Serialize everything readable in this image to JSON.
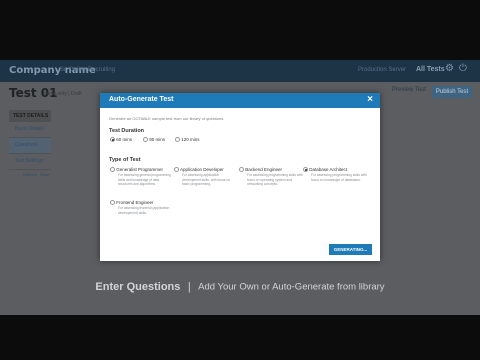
{
  "app": {
    "brand": "Company name",
    "brand_sub": "Sr. Online Recruiting",
    "project": "Production Server",
    "all_tests": "All Tests"
  },
  "test": {
    "title": "Test 01",
    "subtitle": "Invite-only | Draft",
    "preview_label": "Preview Test",
    "publish_label": "Publish Test"
  },
  "sidebar": {
    "header": "TEST DETAILS",
    "items": [
      {
        "label": "Basic Details"
      },
      {
        "label": "Questions"
      },
      {
        "label": "Test Settings"
      }
    ],
    "subitems": [
      {
        "label": "Options"
      },
      {
        "label": "Save"
      }
    ]
  },
  "modal": {
    "title": "Auto-Generate Test",
    "close": "×",
    "intro": "Generate an OOTABLE sample test from our library of questions.",
    "duration_heading": "Test Duration",
    "durations": [
      {
        "label": "60 mins",
        "selected": true
      },
      {
        "label": "90 mins",
        "selected": false
      },
      {
        "label": "120 mins",
        "selected": false
      }
    ],
    "type_heading": "Type of Test",
    "types": [
      {
        "label": "Generalist Programmer",
        "desc": "For assessing general programming skills and knowledge of data structures and algorithms.",
        "selected": false
      },
      {
        "label": "Application Developer",
        "desc": "For assessing application development skills, with focus on basic programming.",
        "selected": false
      },
      {
        "label": "Backend Engineer",
        "desc": "For assessing programming skills with focus on operating system and networking concepts.",
        "selected": false
      },
      {
        "label": "Database Architect",
        "desc": "For assessing programming skills with focus on knowledge of databases.",
        "selected": true
      },
      {
        "label": "Frontend Engineer",
        "desc": "For assessing frontend (application development) skills.",
        "selected": false
      }
    ],
    "generate_label": "GENERATING..."
  },
  "caption": {
    "main": "Enter Questions",
    "sep": "|",
    "sub": "Add Your Own or Auto-Generate from library"
  },
  "colors": {
    "accent": "#1f7ab8",
    "topbar": "#1d3346",
    "overlay": "#5b5d60"
  }
}
